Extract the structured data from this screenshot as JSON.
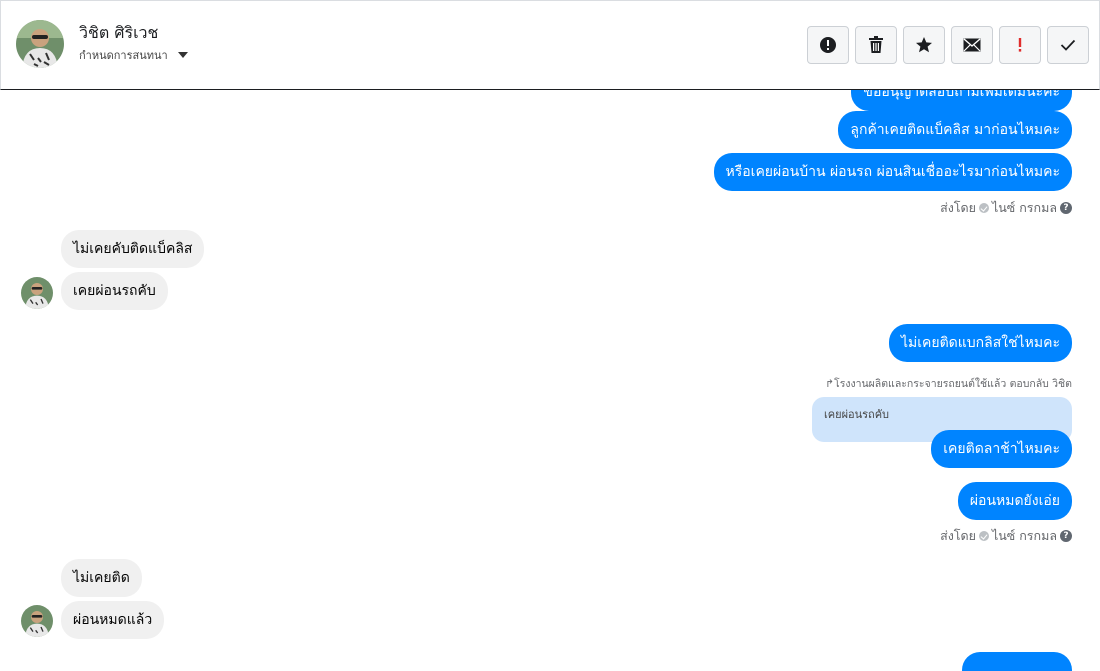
{
  "header": {
    "contact_name": "วิชิต ศิริเวช",
    "chat_options_label": "กำหนดการสนทนา",
    "toolbar": [
      {
        "name": "alert-button",
        "icon": "alert-circle-icon"
      },
      {
        "name": "delete-button",
        "icon": "trash-icon"
      },
      {
        "name": "star-button",
        "icon": "star-icon"
      },
      {
        "name": "mark-unread-button",
        "icon": "envelope-icon"
      },
      {
        "name": "important-button",
        "icon": "exclamation-icon"
      },
      {
        "name": "done-button",
        "icon": "check-icon"
      }
    ]
  },
  "colors": {
    "outgoing_bubble": "#0084ff",
    "incoming_bubble": "#f0f0f0",
    "quoted_bubble": "#cfe4fb",
    "important": "#e02d2d"
  },
  "messages": {
    "out_1_partial": "ขออนุญาตสอบถามเพิ่มเติมนะคะ",
    "out_2": "ลูกค้าเคยติดแบ็คลิส มาก่อนไหมคะ",
    "out_3": "หรือเคยผ่อนบ้าน ผ่อนรถ ผ่อนสินเชื่ออะไรมาก่อนไหมคะ",
    "sent_by_1": {
      "prefix": "ส่งโดย",
      "name": "ไนซ์ กรกมล"
    },
    "in_1": "ไม่เคยคับติดแบ็คลิส",
    "in_2": "เคยผ่อนรถคับ",
    "out_4": "ไม่เคยติดแบกลิสใช่ไหมคะ",
    "reply_label": "↱โรงงานผลิตและกระจายรถยนต์ใช้แล้ว ตอบกลับ วิชิต",
    "quoted_text": "เคยผ่อนรถคับ",
    "out_5": "เคยติดลาช้าไหมคะ",
    "out_6": "ผ่อนหมดยังเอ่ย",
    "sent_by_2": {
      "prefix": "ส่งโดย",
      "name": "ไนซ์ กรกมล"
    },
    "in_3": "ไม่เคยติด",
    "in_4": "ผ่อนหมดแล้ว"
  }
}
